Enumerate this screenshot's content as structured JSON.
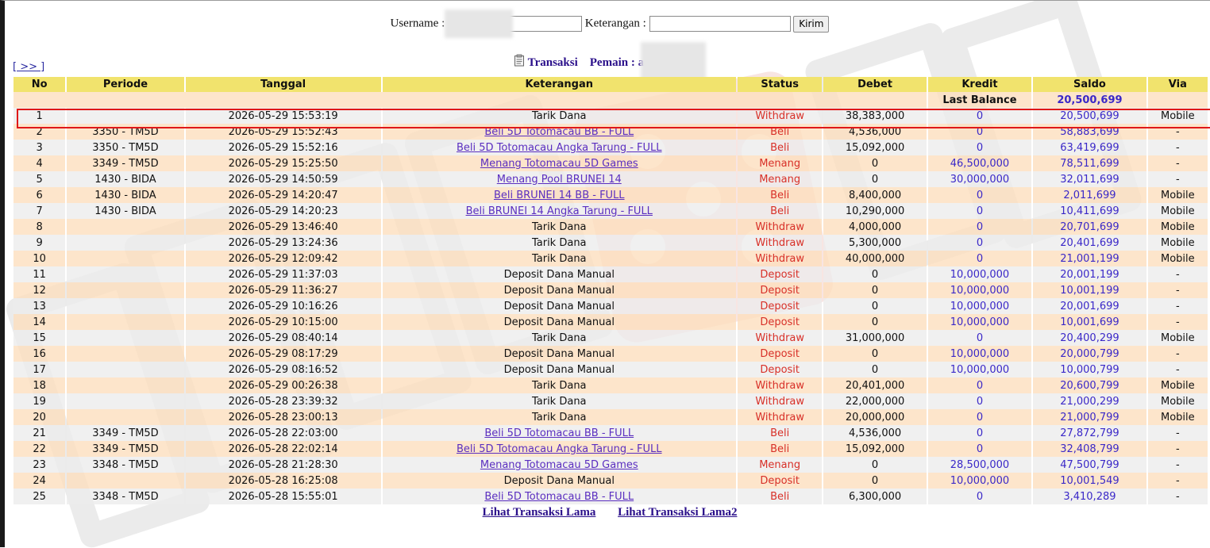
{
  "form": {
    "username_label": "Username :",
    "keterangan_label": "Keterangan :",
    "submit_label": "Kirim"
  },
  "subtitle": {
    "transaksi_label": "Transaksi",
    "pemain_label": "Pemain : a"
  },
  "nav": {
    "next_label": "[ >> ]"
  },
  "table": {
    "headers": [
      "No",
      "Periode",
      "Tanggal",
      "Keterangan",
      "Status",
      "Debet",
      "Kredit",
      "Saldo",
      "Via"
    ],
    "last_balance_label": "Last Balance",
    "last_balance_value": "20,500,699",
    "rows": [
      {
        "no": "1",
        "periode": "",
        "tanggal": "2026-05-29 15:53:19",
        "ket": "Tarik Dana",
        "link": false,
        "status": "Withdraw",
        "debet": "38,383,000",
        "kredit": "0",
        "saldo": "20,500,699",
        "via": "Mobile"
      },
      {
        "no": "2",
        "periode": "3350 - TM5D",
        "tanggal": "2026-05-29 15:52:43",
        "ket": "Beli 5D Totomacau BB - FULL",
        "link": true,
        "status": "Beli",
        "debet": "4,536,000",
        "kredit": "0",
        "saldo": "58,883,699",
        "via": "-"
      },
      {
        "no": "3",
        "periode": "3350 - TM5D",
        "tanggal": "2026-05-29 15:52:16",
        "ket": "Beli 5D Totomacau Angka Tarung - FULL",
        "link": true,
        "status": "Beli",
        "debet": "15,092,000",
        "kredit": "0",
        "saldo": "63,419,699",
        "via": "-"
      },
      {
        "no": "4",
        "periode": "3349 - TM5D",
        "tanggal": "2026-05-29 15:25:50",
        "ket": "Menang Totomacau 5D Games",
        "link": true,
        "status": "Menang",
        "debet": "0",
        "kredit": "46,500,000",
        "saldo": "78,511,699",
        "via": "-"
      },
      {
        "no": "5",
        "periode": "1430 - BIDA",
        "tanggal": "2026-05-29 14:50:59",
        "ket": "Menang Pool BRUNEI 14",
        "link": true,
        "status": "Menang",
        "debet": "0",
        "kredit": "30,000,000",
        "saldo": "32,011,699",
        "via": "-"
      },
      {
        "no": "6",
        "periode": "1430 - BIDA",
        "tanggal": "2026-05-29 14:20:47",
        "ket": "Beli BRUNEI 14 BB - FULL",
        "link": true,
        "status": "Beli",
        "debet": "8,400,000",
        "kredit": "0",
        "saldo": "2,011,699",
        "via": "Mobile"
      },
      {
        "no": "7",
        "periode": "1430 - BIDA",
        "tanggal": "2026-05-29 14:20:23",
        "ket": "Beli BRUNEI 14 Angka Tarung - FULL",
        "link": true,
        "status": "Beli",
        "debet": "10,290,000",
        "kredit": "0",
        "saldo": "10,411,699",
        "via": "Mobile"
      },
      {
        "no": "8",
        "periode": "",
        "tanggal": "2026-05-29 13:46:40",
        "ket": "Tarik Dana",
        "link": false,
        "status": "Withdraw",
        "debet": "4,000,000",
        "kredit": "0",
        "saldo": "20,701,699",
        "via": "Mobile"
      },
      {
        "no": "9",
        "periode": "",
        "tanggal": "2026-05-29 13:24:36",
        "ket": "Tarik Dana",
        "link": false,
        "status": "Withdraw",
        "debet": "5,300,000",
        "kredit": "0",
        "saldo": "20,401,699",
        "via": "Mobile"
      },
      {
        "no": "10",
        "periode": "",
        "tanggal": "2026-05-29 12:09:42",
        "ket": "Tarik Dana",
        "link": false,
        "status": "Withdraw",
        "debet": "40,000,000",
        "kredit": "0",
        "saldo": "21,001,199",
        "via": "Mobile"
      },
      {
        "no": "11",
        "periode": "",
        "tanggal": "2026-05-29 11:37:03",
        "ket": "Deposit Dana Manual",
        "link": false,
        "status": "Deposit",
        "debet": "0",
        "kredit": "10,000,000",
        "saldo": "20,001,199",
        "via": "-"
      },
      {
        "no": "12",
        "periode": "",
        "tanggal": "2026-05-29 11:36:27",
        "ket": "Deposit Dana Manual",
        "link": false,
        "status": "Deposit",
        "debet": "0",
        "kredit": "10,000,000",
        "saldo": "10,001,199",
        "via": "-"
      },
      {
        "no": "13",
        "periode": "",
        "tanggal": "2026-05-29 10:16:26",
        "ket": "Deposit Dana Manual",
        "link": false,
        "status": "Deposit",
        "debet": "0",
        "kredit": "10,000,000",
        "saldo": "20,001,699",
        "via": "-"
      },
      {
        "no": "14",
        "periode": "",
        "tanggal": "2026-05-29 10:15:00",
        "ket": "Deposit Dana Manual",
        "link": false,
        "status": "Deposit",
        "debet": "0",
        "kredit": "10,000,000",
        "saldo": "10,001,699",
        "via": "-"
      },
      {
        "no": "15",
        "periode": "",
        "tanggal": "2026-05-29 08:40:14",
        "ket": "Tarik Dana",
        "link": false,
        "status": "Withdraw",
        "debet": "31,000,000",
        "kredit": "0",
        "saldo": "20,400,299",
        "via": "Mobile"
      },
      {
        "no": "16",
        "periode": "",
        "tanggal": "2026-05-29 08:17:29",
        "ket": "Deposit Dana Manual",
        "link": false,
        "status": "Deposit",
        "debet": "0",
        "kredit": "10,000,000",
        "saldo": "20,000,799",
        "via": "-"
      },
      {
        "no": "17",
        "periode": "",
        "tanggal": "2026-05-29 08:16:52",
        "ket": "Deposit Dana Manual",
        "link": false,
        "status": "Deposit",
        "debet": "0",
        "kredit": "10,000,000",
        "saldo": "10,000,799",
        "via": "-"
      },
      {
        "no": "18",
        "periode": "",
        "tanggal": "2026-05-29 00:26:38",
        "ket": "Tarik Dana",
        "link": false,
        "status": "Withdraw",
        "debet": "20,401,000",
        "kredit": "0",
        "saldo": "20,600,799",
        "via": "Mobile"
      },
      {
        "no": "19",
        "periode": "",
        "tanggal": "2026-05-28 23:39:32",
        "ket": "Tarik Dana",
        "link": false,
        "status": "Withdraw",
        "debet": "22,000,000",
        "kredit": "0",
        "saldo": "21,000,299",
        "via": "Mobile"
      },
      {
        "no": "20",
        "periode": "",
        "tanggal": "2026-05-28 23:00:13",
        "ket": "Tarik Dana",
        "link": false,
        "status": "Withdraw",
        "debet": "20,000,000",
        "kredit": "0",
        "saldo": "21,000,799",
        "via": "Mobile"
      },
      {
        "no": "21",
        "periode": "3349 - TM5D",
        "tanggal": "2026-05-28 22:03:00",
        "ket": "Beli 5D Totomacau BB - FULL",
        "link": true,
        "status": "Beli",
        "debet": "4,536,000",
        "kredit": "0",
        "saldo": "27,872,799",
        "via": "-"
      },
      {
        "no": "22",
        "periode": "3349 - TM5D",
        "tanggal": "2026-05-28 22:02:14",
        "ket": "Beli 5D Totomacau Angka Tarung - FULL",
        "link": true,
        "status": "Beli",
        "debet": "15,092,000",
        "kredit": "0",
        "saldo": "32,408,799",
        "via": "-"
      },
      {
        "no": "23",
        "periode": "3348 - TM5D",
        "tanggal": "2026-05-28 21:28:30",
        "ket": "Menang Totomacau 5D Games",
        "link": true,
        "status": "Menang",
        "debet": "0",
        "kredit": "28,500,000",
        "saldo": "47,500,799",
        "via": "-"
      },
      {
        "no": "24",
        "periode": "",
        "tanggal": "2026-05-28 16:25:08",
        "ket": "Deposit Dana Manual",
        "link": false,
        "status": "Deposit",
        "debet": "0",
        "kredit": "10,000,000",
        "saldo": "10,001,549",
        "via": "-"
      },
      {
        "no": "25",
        "periode": "3348 - TM5D",
        "tanggal": "2026-05-28 15:55:01",
        "ket": "Beli 5D Totomacau BB - FULL",
        "link": true,
        "status": "Beli",
        "debet": "6,300,000",
        "kredit": "0",
        "saldo": "3,410,289",
        "via": "-"
      }
    ]
  },
  "footer": {
    "link1": "Lihat Transaksi Lama",
    "link2": "Lihat Transaksi Lama2"
  },
  "colors": {
    "header_bg": "#f1e36d",
    "row_odd": "#ececec",
    "row_even": "#fddfbe",
    "status_red": "#d83028",
    "value_blue": "#3a28c8",
    "link_purple": "#5a2ec0",
    "highlight_box": "#e01818"
  },
  "icons": {
    "transaksi_icon": "clipboard-icon"
  }
}
